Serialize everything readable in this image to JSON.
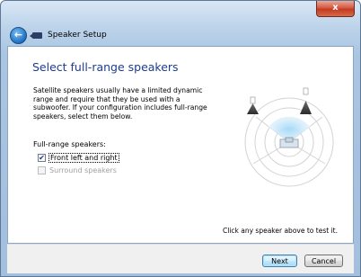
{
  "window": {
    "close_glyph": "x",
    "title": "Speaker Setup"
  },
  "page": {
    "heading": "Select full-range speakers",
    "description": "Satellite speakers usually have a limited dynamic range and require that they be used with a subwoofer.  If your configuration includes full-range speakers, select them below.",
    "full_range_label": "Full-range speakers:",
    "options": [
      {
        "label": "Front left and right",
        "checked": true,
        "enabled": true
      },
      {
        "label": "Surround speakers",
        "checked": false,
        "enabled": false
      }
    ],
    "hint": "Click any speaker above to test it."
  },
  "footer": {
    "next_label": "Next",
    "cancel_label": "Cancel"
  },
  "colors": {
    "heading": "#1e3d8f",
    "accent_blue": "#3c7fb1",
    "close_red": "#c43a1f"
  }
}
